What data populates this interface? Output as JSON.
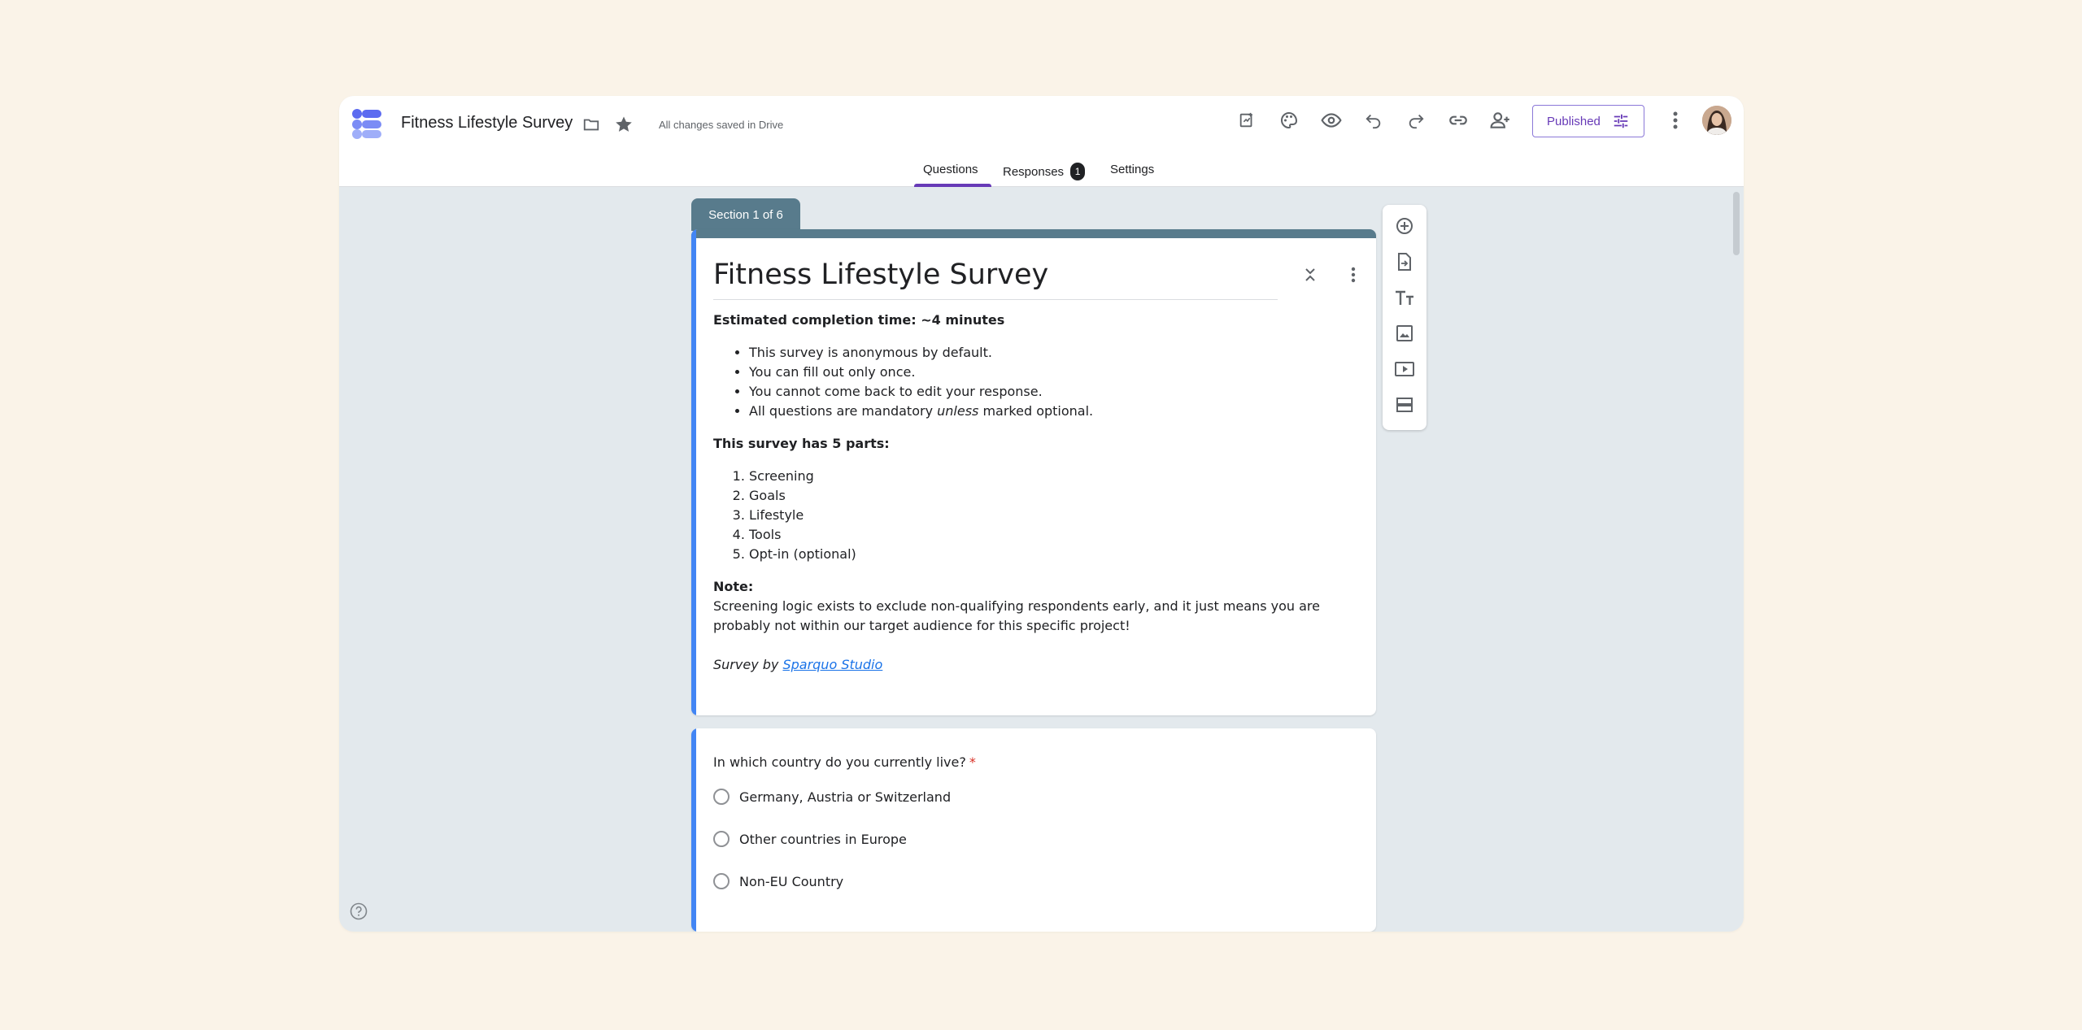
{
  "app": {
    "doc_title": "Fitness Lifestyle Survey",
    "save_status": "All changes saved in Drive",
    "publish_label": "Published",
    "colors": {
      "accent": "#673AB7",
      "section": "#587B8C",
      "active_card": "#4285F4"
    }
  },
  "toolbar_icons": [
    "folder-icon",
    "star-icon",
    "addon-icon",
    "palette-icon",
    "preview-icon",
    "undo-icon",
    "redo-icon",
    "link-icon",
    "add-collaborator-icon",
    "more-icon"
  ],
  "tabs": [
    {
      "label": "Questions"
    },
    {
      "label": "Responses",
      "badge": "1"
    },
    {
      "label": "Settings"
    }
  ],
  "section": {
    "label": "Section 1 of 6"
  },
  "form": {
    "title": "Fitness Lifestyle Survey",
    "estimate": "Estimated completion time: ~4 minutes",
    "rules": [
      "This survey is anonymous by default.",
      "You can fill out only once.",
      "You cannot come back to edit your response."
    ],
    "rule_last": {
      "before": "All questions are mandatory ",
      "em": "unless",
      "after": " marked optional."
    },
    "parts_heading": "This survey has 5 parts:",
    "parts": [
      "Screening",
      "Goals",
      "Lifestyle",
      "Tools",
      "Opt-in (optional)"
    ],
    "note_heading": "Note:",
    "note_text": "Screening logic exists to exclude non-qualifying respondents early, and it just means you are probably not within our target audience for this specific project!",
    "credit_prefix": "Survey by ",
    "credit_link": "Sparquo Studio"
  },
  "question": {
    "text": "In which country do you currently live?",
    "required_mark": "*",
    "options": [
      "Germany, Austria or Switzerland",
      "Other countries in Europe",
      "Non-EU Country"
    ]
  },
  "side_toolbar": [
    "add-question-icon",
    "import-questions-icon",
    "add-title-icon",
    "add-image-icon",
    "add-video-icon",
    "add-section-icon"
  ]
}
